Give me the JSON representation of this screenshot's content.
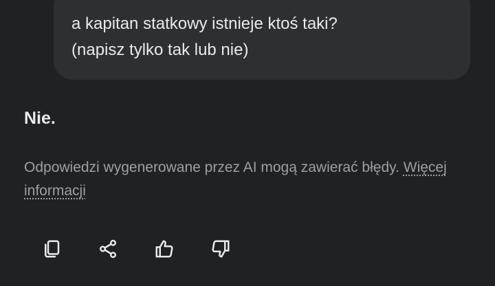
{
  "conversation": {
    "user_message": "a kapitan statkowy istnieje ktoś taki?\n(napisz tylko tak lub nie)",
    "assistant_answer": "Nie.",
    "disclaimer_text": "Odpowiedzi wygenerowane przez AI mogą zawierać błędy.",
    "disclaimer_link": "Więcej informacji"
  },
  "actions": {
    "icons": [
      "copy-icon",
      "share-icon",
      "thumbs-up-icon",
      "thumbs-down-icon"
    ]
  },
  "colors": {
    "background": "#202124",
    "bubble": "#2d2f33",
    "text": "#e8eaed",
    "muted_text": "#9aa0a6"
  }
}
